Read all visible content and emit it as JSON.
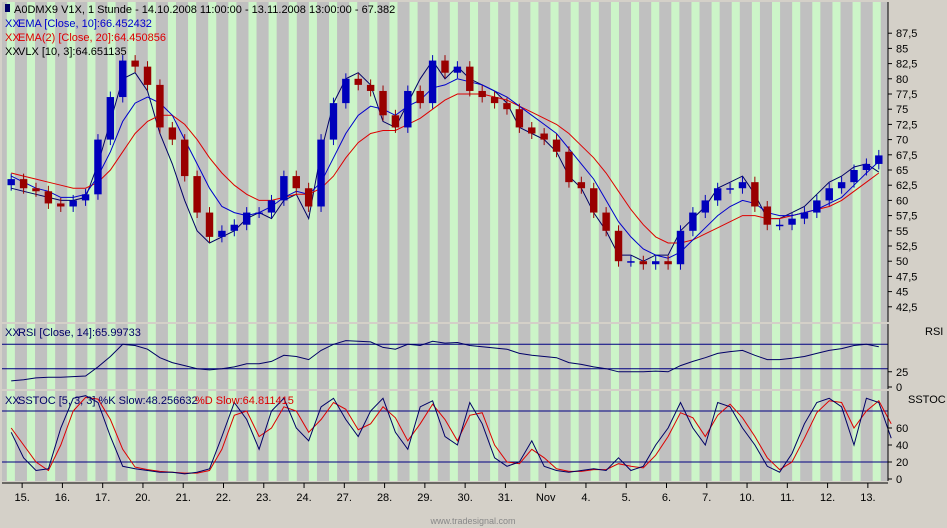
{
  "colors": {
    "background": "#c0c0c0",
    "stripe": "#ccf5c8",
    "ema10": "#0000cc",
    "ema20": "#dd0000",
    "vlx": "#000066",
    "candle_up": "#0000bb",
    "candle_down": "#990000",
    "rsi": "#000066",
    "stoch_k": "#000066",
    "stoch_d": "#dd0000",
    "guide": "#000080"
  },
  "watermark": "www.tradesignal.com",
  "chart_data": [
    {
      "type": "candlestick",
      "header": "A0DMX9 V1X, 1 Stunde - 14.10.2008 11:00:00 - 13.11.2008 13:00:00 - 67.382",
      "legend": [
        {
          "prefix": "XX",
          "text": "EMA [Close, 10]:66.452432",
          "color": "#0000cc"
        },
        {
          "prefix": "XX",
          "text": "EMA(2) [Close, 20]:64.450856",
          "color": "#dd0000"
        },
        {
          "prefix": "XX",
          "text": "VLX [10, 3]:64.651135",
          "color": "#000000"
        }
      ],
      "y_ticks": [
        "87,5",
        "85",
        "82,5",
        "80",
        "77,5",
        "75",
        "72,5",
        "70",
        "67,5",
        "65",
        "62,5",
        "60",
        "57,5",
        "55",
        "52,5",
        "50",
        "47,5",
        "45",
        "42,5"
      ],
      "ylim": [
        40,
        90
      ],
      "x_labels": [
        "15.",
        "16.",
        "17.",
        "20.",
        "21.",
        "22.",
        "23.",
        "24.",
        "27.",
        "28.",
        "29.",
        "30.",
        "31.",
        "Nov",
        "4.",
        "5.",
        "6.",
        "7.",
        "10.",
        "11.",
        "12.",
        "13."
      ],
      "series": [
        {
          "name": "Close",
          "role": "close",
          "values": [
            63.5,
            62,
            61.5,
            59.5,
            59,
            60,
            61,
            70,
            77,
            83,
            82,
            79,
            72,
            70,
            64,
            58,
            54,
            55,
            56,
            58,
            58,
            60,
            64,
            62,
            59,
            70,
            76,
            80,
            79,
            78,
            74,
            72,
            78,
            76,
            83,
            81,
            82,
            78,
            77,
            76,
            75,
            72,
            71,
            70,
            68,
            63,
            62,
            58,
            55,
            50,
            50,
            49.5,
            50,
            49.5,
            55,
            58,
            60,
            62,
            62,
            63,
            59,
            56,
            56,
            57,
            58,
            60,
            62,
            63,
            65,
            66,
            67.4
          ]
        },
        {
          "name": "EMA [Close, 10]",
          "role": "ema10",
          "values": [
            64,
            63,
            62,
            61.5,
            60.5,
            60.5,
            61,
            64,
            68,
            73,
            76,
            77,
            76,
            74,
            70,
            66,
            62,
            59,
            58,
            57.5,
            58,
            59,
            60.5,
            61.5,
            61,
            63,
            67,
            71,
            74,
            75.5,
            75,
            74,
            75.5,
            76.5,
            78.5,
            79,
            80,
            79.5,
            79,
            78,
            77,
            75.5,
            74,
            72.5,
            71,
            68.5,
            66,
            63.5,
            60,
            56.5,
            54,
            52,
            51,
            50.5,
            51.5,
            53.5,
            55.5,
            57.5,
            59,
            60,
            59.5,
            58,
            57.5,
            57.5,
            58,
            58.5,
            59.5,
            60.5,
            62.5,
            64.5,
            66.4
          ]
        },
        {
          "name": "EMA(2) [Close, 20]",
          "role": "ema20",
          "values": [
            64.5,
            64,
            63.5,
            63,
            62.5,
            62,
            62,
            63,
            65,
            68,
            71,
            73,
            74,
            74,
            72.5,
            70,
            67,
            64.5,
            62.5,
            61,
            60,
            60,
            60.5,
            61,
            61,
            62,
            64,
            67,
            69.5,
            71,
            71.5,
            71.5,
            72.5,
            73.5,
            75,
            76.5,
            77.5,
            77.5,
            77.5,
            77,
            76.5,
            75.5,
            74.5,
            73.5,
            72.5,
            71,
            69,
            67,
            64.5,
            61.5,
            58.5,
            56,
            54,
            53,
            53,
            53.5,
            54.5,
            55.5,
            56.5,
            57.5,
            57.5,
            57,
            57,
            57.5,
            58,
            58.5,
            59,
            60,
            61.5,
            63,
            64.5
          ]
        },
        {
          "name": "VLX [10, 3]",
          "role": "vlx",
          "values": [
            62,
            61.5,
            61,
            60.5,
            60,
            60,
            60.5,
            66,
            73,
            80,
            81,
            78,
            71,
            66,
            60,
            55,
            53,
            54,
            55,
            57,
            58,
            57,
            60,
            61,
            57,
            68,
            76,
            80,
            81,
            79,
            73,
            72,
            76,
            80,
            83,
            80,
            82,
            80,
            79,
            78,
            76,
            72,
            71,
            70,
            68,
            64,
            62,
            58,
            55,
            51,
            51,
            50,
            51,
            51,
            55,
            57,
            59,
            62,
            63,
            64,
            61,
            57,
            57,
            58,
            59,
            61,
            63,
            64,
            65.5,
            66,
            64.65
          ]
        }
      ]
    },
    {
      "type": "line",
      "label": "RSI",
      "legend": {
        "prefix": "XX",
        "text": "RSI [Close, 14]:65.99733"
      },
      "y_ticks": [
        "25",
        "0"
      ],
      "ylim": [
        0,
        100
      ],
      "guides": [
        30,
        70
      ],
      "series": [
        {
          "name": "RSI [Close, 14]",
          "values": [
            10,
            12,
            15,
            16,
            16,
            17,
            18,
            33,
            50,
            70,
            68,
            62,
            48,
            40,
            35,
            30,
            28,
            30,
            33,
            38,
            38,
            42,
            52,
            50,
            45,
            60,
            70,
            76,
            75,
            74,
            65,
            62,
            70,
            68,
            75,
            72,
            73,
            68,
            66,
            64,
            62,
            55,
            52,
            50,
            48,
            40,
            37,
            33,
            30,
            25,
            25,
            25,
            26,
            25,
            35,
            42,
            48,
            55,
            58,
            60,
            52,
            45,
            45,
            47,
            50,
            55,
            60,
            63,
            68,
            70,
            66
          ]
        }
      ]
    },
    {
      "type": "line",
      "label": "SSTOC",
      "legend": [
        {
          "prefix": "XX",
          "text": "SSTOC [5, 3, 3] %K Slow:48.256632",
          "color": "#000066"
        },
        {
          "prefix": "",
          "text": "%D Slow:64.811415",
          "color": "#dd0000"
        }
      ],
      "y_ticks": [
        "60",
        "40",
        "20",
        "0"
      ],
      "ylim": [
        0,
        100
      ],
      "guides": [
        20,
        80
      ],
      "series": [
        {
          "name": "%K Slow",
          "values": [
            55,
            25,
            10,
            12,
            60,
            95,
            98,
            90,
            50,
            15,
            12,
            10,
            8,
            8,
            6,
            8,
            12,
            50,
            90,
            70,
            35,
            80,
            95,
            60,
            45,
            85,
            95,
            70,
            50,
            80,
            95,
            55,
            35,
            85,
            92,
            50,
            40,
            90,
            65,
            25,
            15,
            20,
            45,
            15,
            10,
            8,
            10,
            12,
            10,
            25,
            10,
            15,
            40,
            60,
            90,
            60,
            40,
            90,
            85,
            60,
            40,
            15,
            8,
            30,
            65,
            90,
            95,
            85,
            40,
            95,
            90,
            48
          ]
        },
        {
          "name": "%D Slow",
          "values": [
            60,
            40,
            20,
            10,
            40,
            80,
            96,
            94,
            70,
            35,
            14,
            11,
            9,
            8,
            7,
            7,
            10,
            35,
            75,
            80,
            50,
            60,
            85,
            80,
            55,
            70,
            90,
            82,
            58,
            65,
            85,
            72,
            45,
            65,
            88,
            70,
            45,
            75,
            78,
            40,
            20,
            18,
            35,
            25,
            12,
            9,
            9,
            11,
            11,
            18,
            15,
            13,
            28,
            50,
            78,
            72,
            50,
            75,
            88,
            72,
            50,
            25,
            11,
            20,
            48,
            78,
            92,
            90,
            60,
            80,
            92,
            65
          ]
        }
      ]
    }
  ]
}
